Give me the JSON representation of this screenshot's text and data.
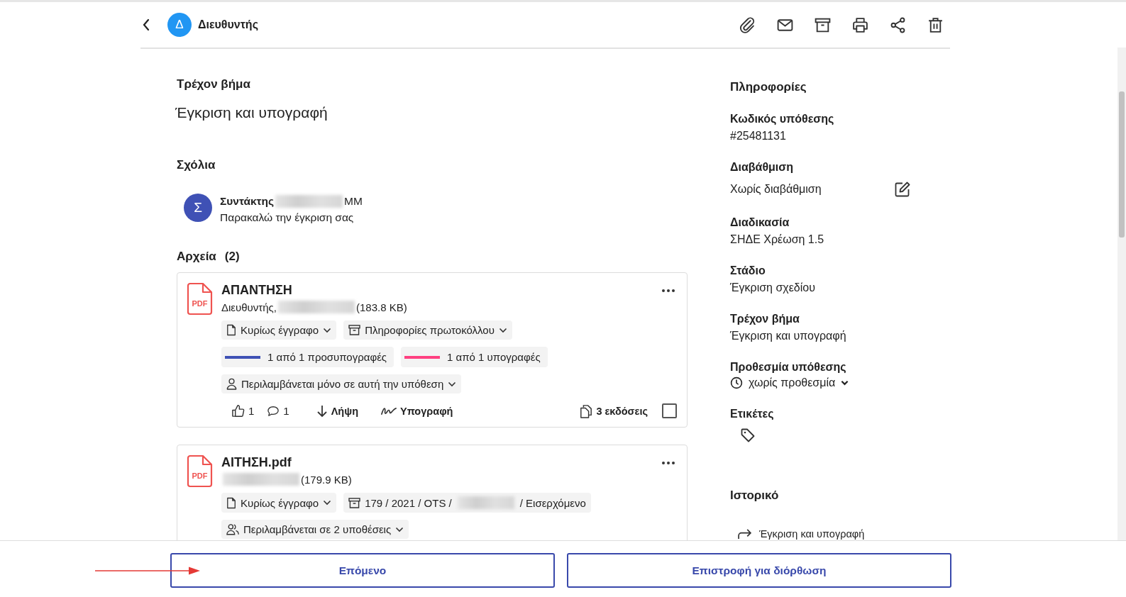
{
  "header": {
    "avatar": "Δ",
    "title": "Διευθυντής"
  },
  "current_step": {
    "label": "Τρέχον βήμα",
    "value": "Έγκριση και υπογραφή"
  },
  "comments": {
    "title": "Σχόλια",
    "items": [
      {
        "avatar": "Σ",
        "author": "Συντάκτης",
        "redacted": true,
        "author_suffix": "MM",
        "text": "Παρακαλώ την έγκριση σας"
      }
    ]
  },
  "files": {
    "title": "Αρχεία",
    "count": "(2)",
    "items": [
      {
        "name": "ΑΠΑΝΤΗΣΗ",
        "badge": "PDF",
        "meta_prefix": "Διευθυντής,",
        "redacted": true,
        "meta_suffix": "(183.8 KB)",
        "chips": [
          {
            "kind": "doc",
            "label": "Κυρίως έγγραφο"
          },
          {
            "kind": "protocol",
            "label": "Πληροφορίες πρωτοκόλλου"
          }
        ],
        "signatures": [
          {
            "label": "1 από 1 προσυπογραφές",
            "color": "#3f51b5"
          },
          {
            "label": "1 από 1 υπογραφές",
            "color": "#ff4081"
          }
        ],
        "scope": {
          "kind": "single",
          "label": "Περιλαμβάνεται μόνο σε αυτή την υπόθεση"
        },
        "actions": {
          "likes": "1",
          "comments": "1",
          "download": "Λήψη",
          "sign": "Υπογραφή",
          "versions": "3 εκδόσεις",
          "checked": false
        }
      },
      {
        "name": "ΑΙΤΗΣΗ.pdf",
        "badge": "PDF",
        "redacted": true,
        "meta_suffix": "(179.9 KB)",
        "chips": [
          {
            "kind": "doc",
            "label": "Κυρίως έγγραφο"
          },
          {
            "kind": "protocol",
            "label": "179 / 2021 / OTS /",
            "redacted": true,
            "label_after": "/ Εισερχόμενο"
          }
        ],
        "scope": {
          "kind": "multi",
          "label": "Περιλαμβάνεται σε 2 υποθέσεις"
        }
      }
    ]
  },
  "info": {
    "title": "Πληροφορίες",
    "fields": [
      {
        "kind": "text",
        "label": "Κωδικός υπόθεσης",
        "value": "#25481131"
      },
      {
        "kind": "editable",
        "label": "Διαβάθμιση",
        "value": "Χωρίς διαβάθμιση"
      },
      {
        "kind": "text",
        "label": "Διαδικασία",
        "value": "ΣΗΔΕ Χρέωση 1.5"
      },
      {
        "kind": "text",
        "label": "Στάδιο",
        "value": "Έγκριση σχεδίου"
      },
      {
        "kind": "text",
        "label": "Τρέχον βήμα",
        "value": "Έγκριση και υπογραφή"
      },
      {
        "kind": "deadline",
        "label": "Προθεσμία υπόθεσης",
        "value": "χωρίς προθεσμία"
      },
      {
        "kind": "tags",
        "label": "Ετικέτες"
      }
    ]
  },
  "history": {
    "title": "Ιστορικό",
    "items": [
      {
        "label": "Έγκριση και υπογραφή"
      }
    ]
  },
  "footer": {
    "buttons": [
      {
        "label": "Επόμενο",
        "pointer": true
      },
      {
        "label": "Επιστροφή για διόρθωση",
        "pointer": false
      }
    ]
  }
}
